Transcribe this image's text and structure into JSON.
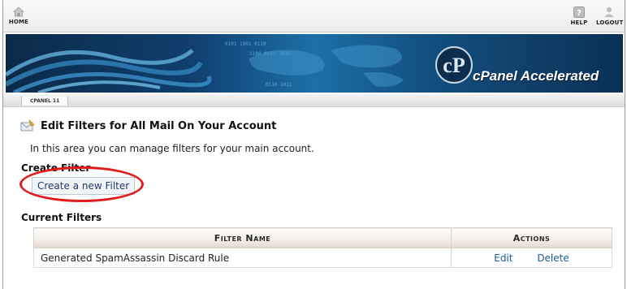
{
  "topbar": {
    "home_label": "HOME",
    "help_label": "HELP",
    "logout_label": "LOGOUT",
    "icons": [
      "home-icon",
      "help-icon",
      "logout-icon"
    ]
  },
  "banner": {
    "brand_text": "cPanel Accelerated"
  },
  "tabstrip": {
    "tab_label": "CPANEL 11"
  },
  "page": {
    "title": "Edit Filters for All Mail On Your Account",
    "description": "In this area you can manage filters for your main account.",
    "create_heading": "Create Filter",
    "create_button": "Create a new Filter",
    "current_heading": "Current Filters"
  },
  "filters_table": {
    "columns": [
      "Filter Name",
      "Actions"
    ],
    "rows": [
      {
        "name": "Generated SpamAssassin Discard Rule",
        "actions": [
          "Edit",
          "Delete"
        ]
      }
    ]
  },
  "colors": {
    "highlight_ring": "#e21c1c",
    "link": "#1d5b9b",
    "banner_blue": "#1d6fa8"
  }
}
